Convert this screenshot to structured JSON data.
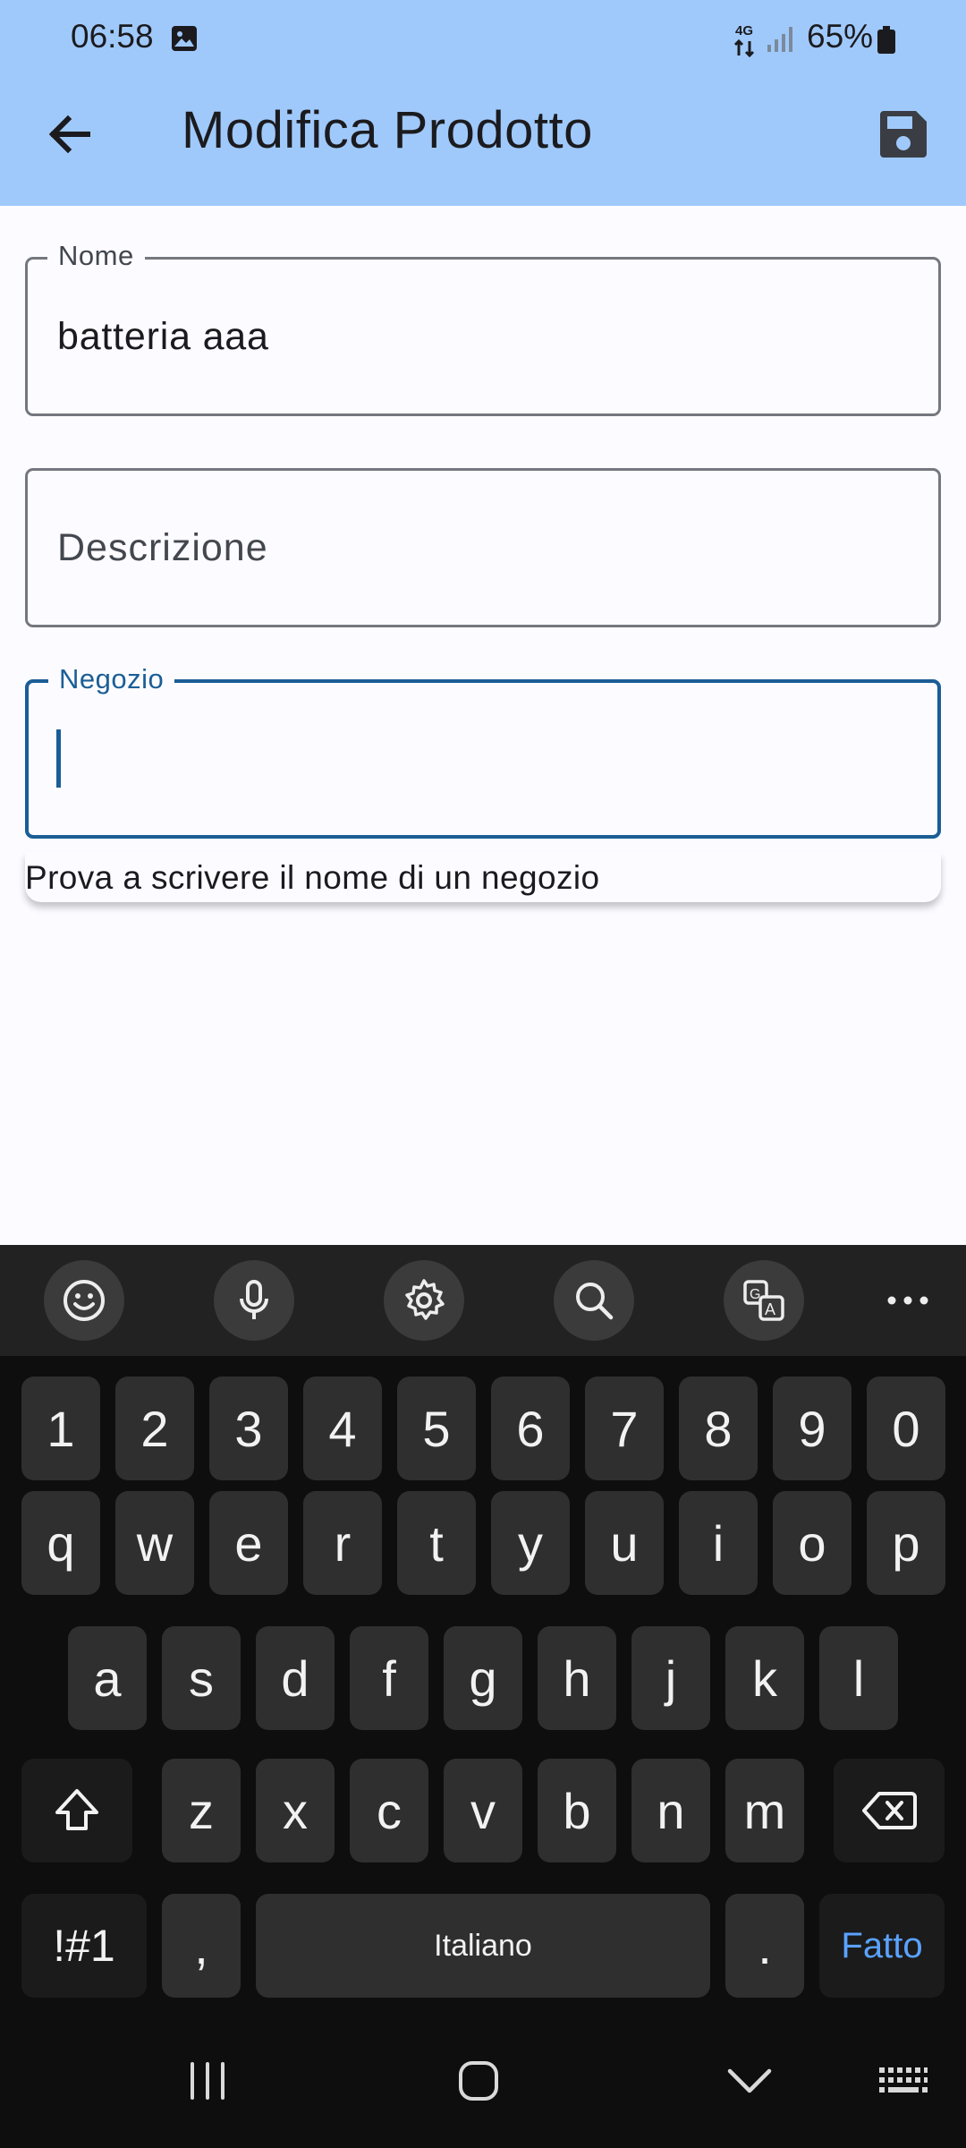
{
  "status_bar": {
    "time": "06:58",
    "network": "4G",
    "battery": "65%"
  },
  "app_bar": {
    "title": "Modifica Prodotto",
    "back_icon": "arrow-left-icon",
    "save_icon": "save-icon",
    "background": "#a0c9fb"
  },
  "form": {
    "nome": {
      "label": "Nome",
      "value": "batteria aaa"
    },
    "descrizione": {
      "placeholder": "Descrizione"
    },
    "negozio": {
      "label": "Negozio",
      "value": ""
    },
    "suggestion": "Prova a scrivere il nome di un negozio",
    "focus_color": "#1b5e96"
  },
  "keyboard": {
    "toolbar": [
      "emoji-icon",
      "microphone-icon",
      "settings-icon",
      "search-icon",
      "translate-icon",
      "more-icon"
    ],
    "row_numbers": [
      "1",
      "2",
      "3",
      "4",
      "5",
      "6",
      "7",
      "8",
      "9",
      "0"
    ],
    "row_q": [
      "q",
      "w",
      "e",
      "r",
      "t",
      "y",
      "u",
      "i",
      "o",
      "p"
    ],
    "row_a": [
      "a",
      "s",
      "d",
      "f",
      "g",
      "h",
      "j",
      "k",
      "l"
    ],
    "row_z": [
      "z",
      "x",
      "c",
      "v",
      "b",
      "n",
      "m"
    ],
    "symbols_label": "!#1",
    "comma_label": ",",
    "space_label": "Italiano",
    "period_label": ".",
    "done_label": "Fatto",
    "done_color": "#5aa2ff"
  },
  "nav_bar": [
    "recents-icon",
    "home-icon",
    "hide-keyboard-icon",
    "keyboard-icon"
  ]
}
